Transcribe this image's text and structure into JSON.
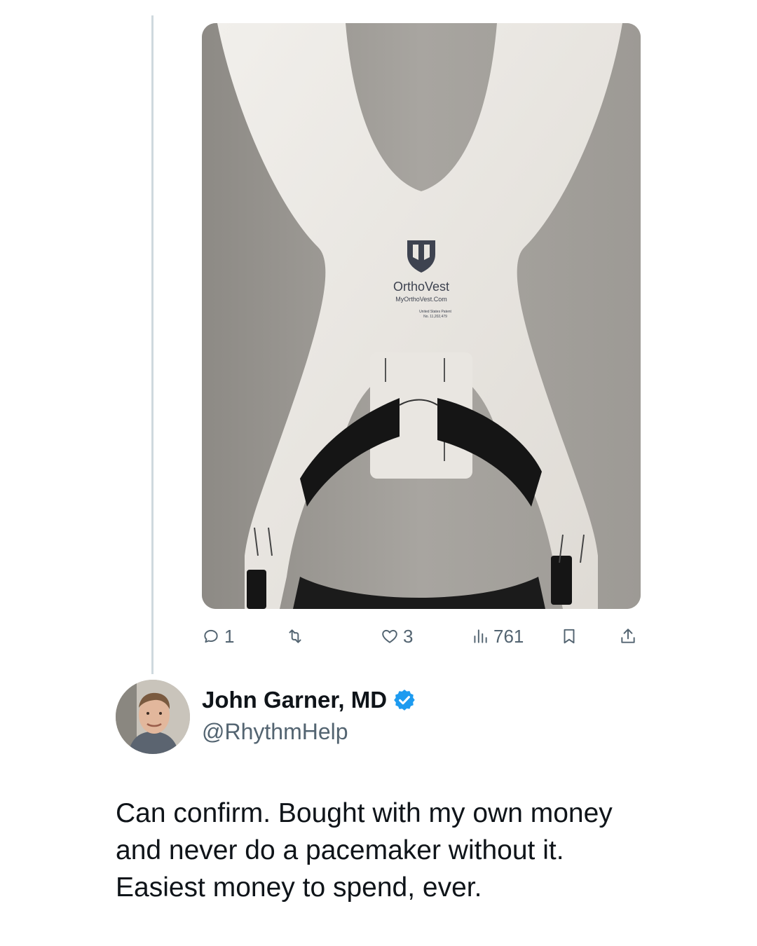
{
  "media": {
    "brand": "OrthoVest",
    "url": "MyOrthoVest.Com",
    "patent_line1": "United States Patent",
    "patent_line2": "No. 11,202,479"
  },
  "actions": {
    "reply_count": "1",
    "like_count": "3",
    "view_count": "761"
  },
  "author": {
    "name": "John Garner, MD",
    "handle": "@RhythmHelp",
    "verified": true
  },
  "tweet": {
    "lines": [
      "Can confirm.  Bought with my own money",
      "and never do a pacemaker without it.",
      "Easiest money to spend, ever."
    ]
  },
  "colors": {
    "verified_badge": "#1d9bf0",
    "muted_text": "#536471",
    "thread_line": "#cfd9de"
  }
}
